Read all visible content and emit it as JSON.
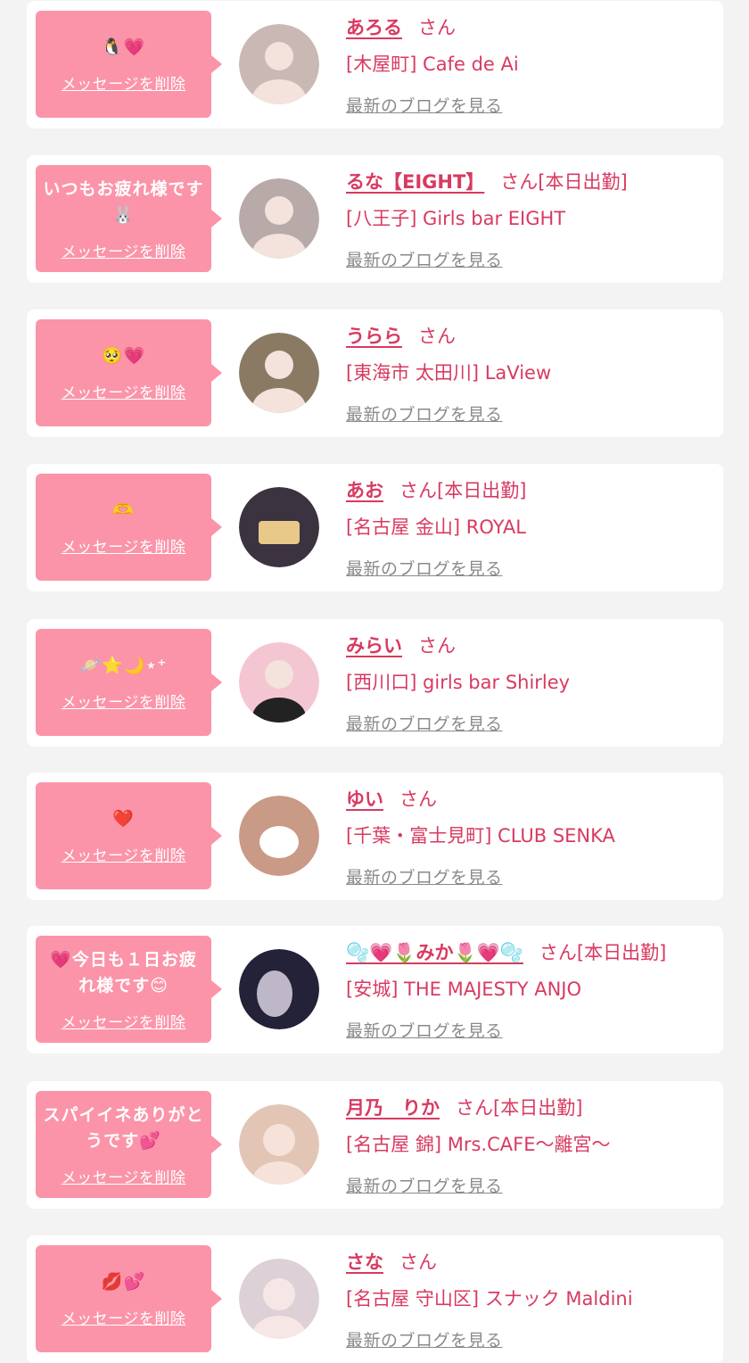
{
  "labels": {
    "delete": "メッセージを削除",
    "blog": "最新のブログを見る",
    "honorific": "さん"
  },
  "cards": [
    {
      "message": "🐧💗",
      "name": "あろる",
      "status": "",
      "shop": "[木屋町] Cafe de Ai",
      "avatar_color": "#c9b8b4"
    },
    {
      "message": "いつもお疲れ様です🐰",
      "name": "るな【EIGHT】",
      "status": "[本日出勤]",
      "shop": "[八王子] Girls bar EIGHT",
      "avatar_color": "#b7aaa8"
    },
    {
      "message": "🥺💗",
      "name": "うらら",
      "status": "",
      "shop": "[東海市 太田川] LaView",
      "avatar_color": "#8a7a63"
    },
    {
      "message": "🫶",
      "name": "あお",
      "status": "[本日出勤]",
      "shop": "[名古屋 金山] ROYAL",
      "avatar_color": "#3b3340"
    },
    {
      "message": "🪐⭐🌙⋆⁺",
      "name": "みらい",
      "status": "",
      "shop": "[西川口] girls bar Shirley",
      "avatar_color": "#f4c6d1"
    },
    {
      "message": "❤️",
      "name": "ゆい",
      "status": "",
      "shop": "[千葉・富士見町] CLUB SENKA",
      "avatar_color": "#c99a86"
    },
    {
      "message": "💗今日も１日お疲れ様です😊",
      "name": "🫧💗🌷みか🌷💗🫧",
      "status": "[本日出勤]",
      "shop": "[安城] THE MAJESTY ANJO",
      "avatar_color": "#232238"
    },
    {
      "message": "スパイイネありがとうです💕",
      "name": "月乃　りか",
      "status": "[本日出勤]",
      "shop": "[名古屋 錦] Mrs.CAFE〜離宮〜",
      "avatar_color": "#e3c5b6"
    },
    {
      "message": "💋💕",
      "name": "さな",
      "status": "",
      "shop": "[名古屋 守山区] スナック Maldini",
      "avatar_color": "#ddd0d6"
    }
  ]
}
